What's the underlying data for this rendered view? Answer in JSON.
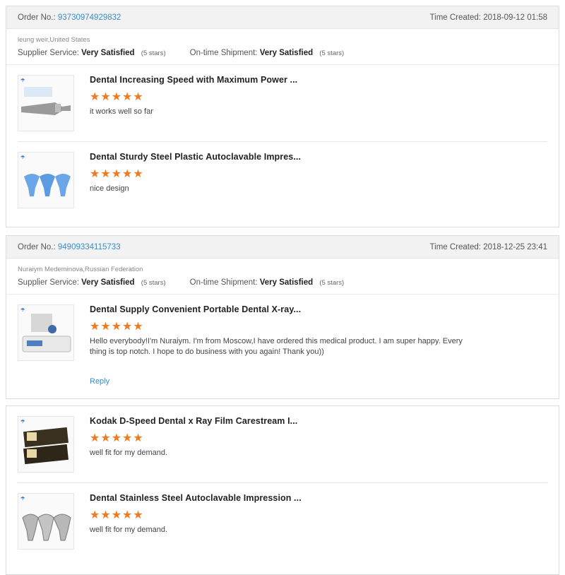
{
  "orders": [
    {
      "order_label": "Order No.:",
      "order_number": "93730974929832",
      "time_label": "Time Created:",
      "time_created": "2018-09-12 01:58",
      "buyer": "leung weir,United States",
      "supplier_label": "Supplier Service:",
      "supplier_value": "Very Satisfied",
      "supplier_stars": "(5 stars)",
      "shipment_label": "On-time Shipment:",
      "shipment_value": "Very Satisfied",
      "shipment_stars": "(5 stars)",
      "items": [
        {
          "title": "Dental Increasing Speed with Maximum Power ...",
          "stars": "★★★★★",
          "comment": "it works well so far"
        },
        {
          "title": "Dental Sturdy Steel Plastic Autoclavable Impres...",
          "stars": "★★★★★",
          "comment": "nice design"
        }
      ]
    },
    {
      "order_label": "Order No.:",
      "order_number": "94909334115733",
      "time_label": "Time Created:",
      "time_created": "2018-12-25 23:41",
      "buyer": "Nuraiym Medeminova,Russian Federation",
      "supplier_label": "Supplier Service:",
      "supplier_value": "Very Satisfied",
      "supplier_stars": "(5 stars)",
      "shipment_label": "On-time Shipment:",
      "shipment_value": "Very Satisfied",
      "shipment_stars": "(5 stars)",
      "items": [
        {
          "title": "Dental Supply Convenient Portable Dental X-ray...",
          "stars": "★★★★★",
          "comment": "Hello everybody!I'm Nuraiym. I'm from Moscow,I have ordered this medical product. I am super happy. Every thing is top notch. I hope to do business with you again! Thank you))",
          "reply": "Reply"
        }
      ]
    },
    {
      "items": [
        {
          "title": "Kodak D-Speed Dental x Ray Film Carestream I...",
          "stars": "★★★★★",
          "comment": "well fit for my demand."
        },
        {
          "title": "Dental Stainless Steel Autoclavable Impression ...",
          "stars": "★★★★★",
          "comment": "well fit for my demand."
        }
      ]
    }
  ],
  "icons": {
    "brand_logo": "shop-logo-icon"
  }
}
